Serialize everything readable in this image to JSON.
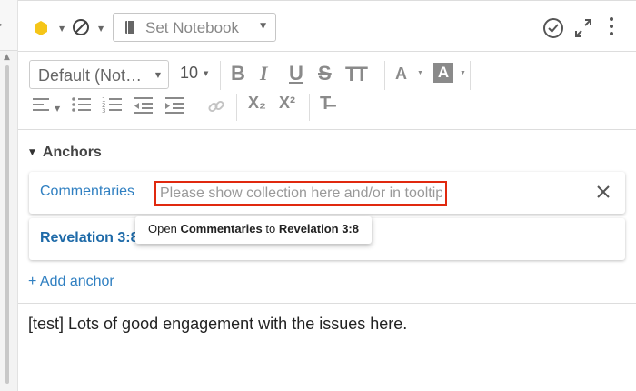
{
  "header": {
    "tag_color": "#f5c518",
    "notebook_select": {
      "label": "Set Notebook",
      "icon": "notebook-icon"
    },
    "icons": [
      "tag-icon",
      "no-entry-icon",
      "check-circle-icon",
      "expand-icon",
      "kebab-menu-icon"
    ]
  },
  "toolbar": {
    "font_family": "Default (Not…",
    "font_size": "10",
    "bold": "B",
    "italic": "I",
    "underline": "U",
    "strikethrough": "S",
    "text_case": "TT",
    "font_color": "A",
    "highlight": "A",
    "subscript": "X₂",
    "superscript": "X²",
    "clear_format": "T̶"
  },
  "anchors": {
    "title": "Anchors",
    "items": [
      {
        "label": "Commentaries",
        "input_placeholder": "Please show collection here and/or in tooltip"
      },
      {
        "label": "Revelation 3:8"
      }
    ],
    "tooltip": {
      "prefix": "Open",
      "target": "Commentaries",
      "joiner": "to",
      "reference": "Revelation 3:8"
    },
    "add_label": "+ Add anchor"
  },
  "note": {
    "text": "[test] Lots of good engagement with the issues here."
  },
  "colors": {
    "link_blue": "#2f7fc1",
    "highlight_red": "#e0290f",
    "icon_gray": "#8a8a8a"
  }
}
